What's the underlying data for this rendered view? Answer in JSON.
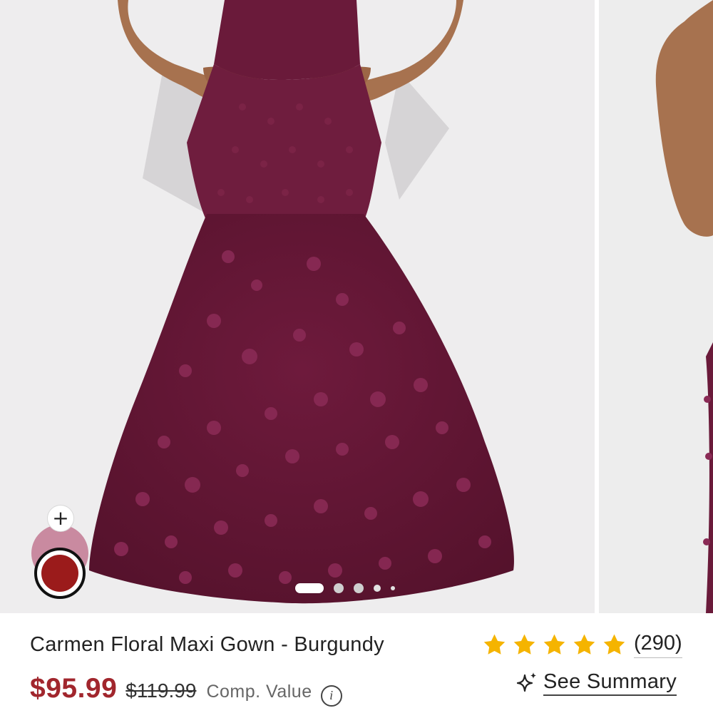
{
  "gallery": {
    "images": [
      {
        "icon": "burgundy-floral-mermaid-gown-photo"
      },
      {
        "icon": "model-arm-photo"
      }
    ],
    "active_index": 0,
    "dot_count": 5
  },
  "swatches": {
    "add_label": "+",
    "colors": {
      "active": "#9b1b1b",
      "alt": "#c98aa0"
    }
  },
  "product": {
    "title": "Carmen Floral Maxi Gown - Burgundy",
    "rating": {
      "stars": 5,
      "max": 5,
      "count": "(290)",
      "star_color": "#f5b400"
    },
    "price": {
      "sale": "$95.99",
      "original": "$119.99",
      "comp_label": "Comp. Value",
      "sale_color": "#a1262d"
    },
    "summary_label": "See Summary"
  }
}
